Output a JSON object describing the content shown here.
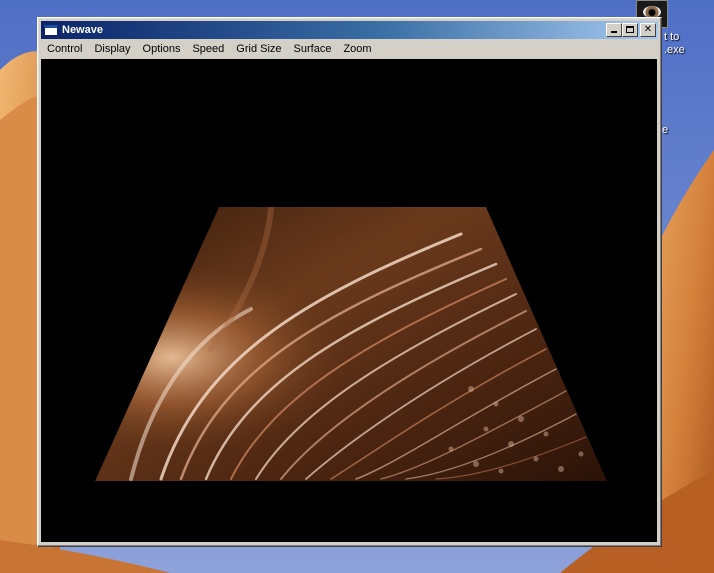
{
  "window": {
    "title": "Newave"
  },
  "menu": [
    {
      "label": "Control"
    },
    {
      "label": "Display"
    },
    {
      "label": "Options"
    },
    {
      "label": "Speed"
    },
    {
      "label": "Grid Size"
    },
    {
      "label": "Surface"
    },
    {
      "label": "Zoom"
    }
  ],
  "desktop": {
    "icon_name": "eye-icon",
    "label_line1": "t to",
    "label_line2": ".exe",
    "label_fragment": "e"
  },
  "render": {
    "surface_color": "#6b3a1c",
    "highlight_color": "#f2d7c4",
    "background_color": "#000000"
  }
}
